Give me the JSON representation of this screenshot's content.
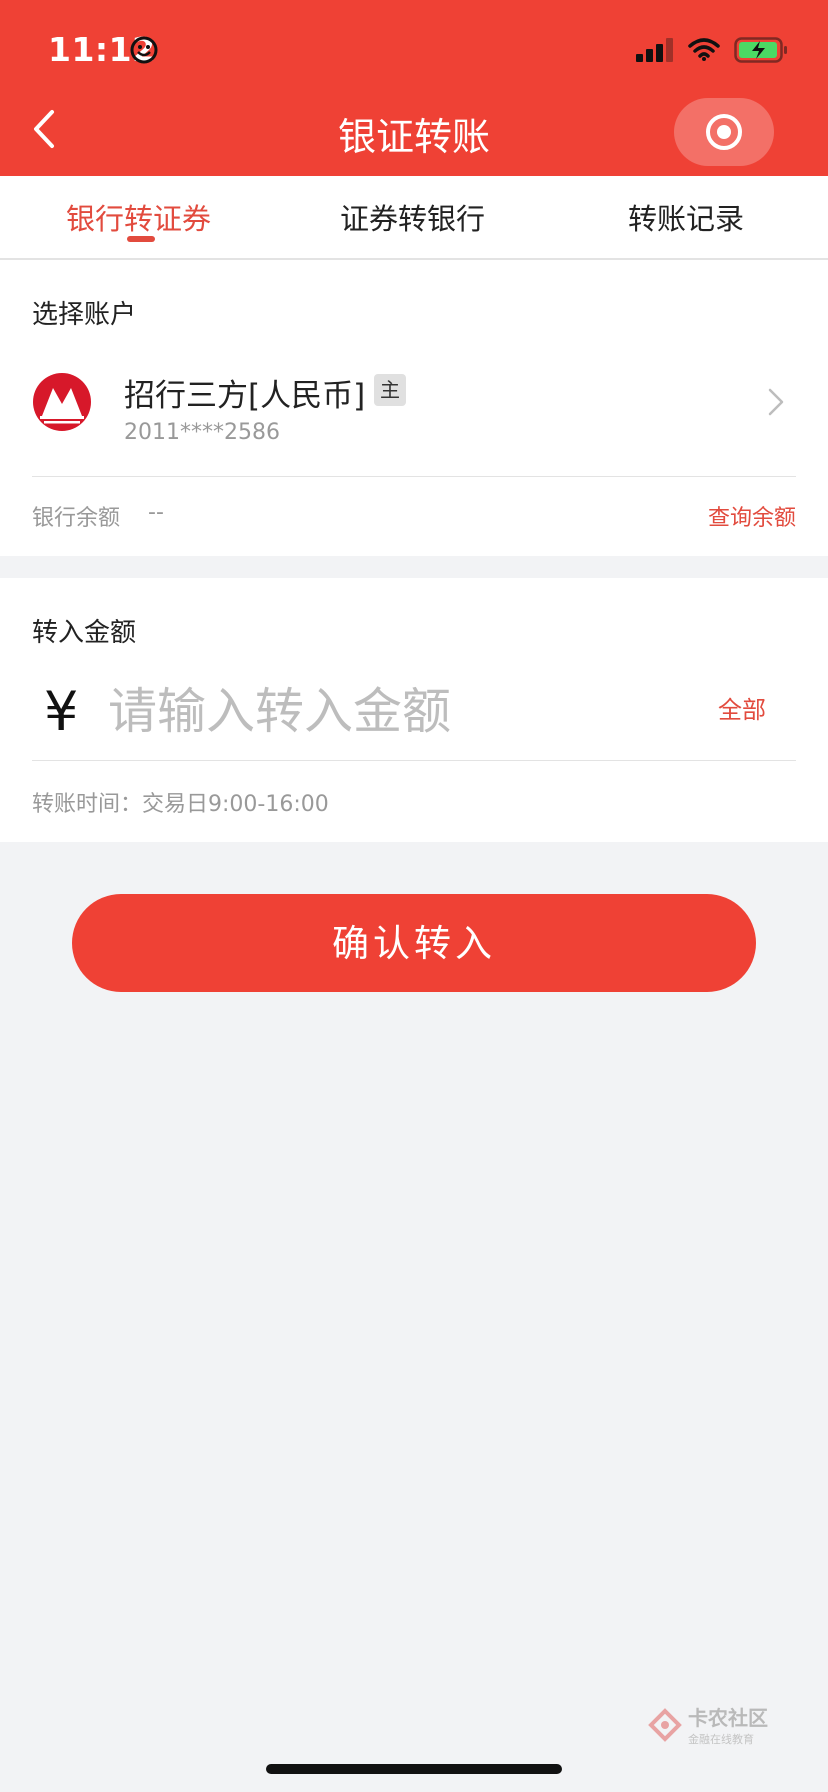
{
  "status_bar": {
    "time": "11:12"
  },
  "nav": {
    "title": "银证转账"
  },
  "tabs": [
    {
      "label": "银行转证券",
      "active": true
    },
    {
      "label": "证券转银行",
      "active": false
    },
    {
      "label": "转账记录",
      "active": false
    }
  ],
  "account": {
    "section_title": "选择账户",
    "bank_name": "招行三方[人民币]",
    "badge": "主",
    "account_number": "2011****2586",
    "balance_label": "银行余额",
    "balance_value": "--",
    "query_label": "查询余额"
  },
  "transfer": {
    "section_title": "转入金额",
    "currency_symbol": "¥",
    "placeholder": "请输入转入金额",
    "all_label": "全部",
    "time_label": "转账时间：交易日9:00-16:00"
  },
  "confirm_label": "确认转入",
  "watermark": {
    "main": "卡农社区",
    "sub": "金融在线教育"
  },
  "colors": {
    "accent": "#ef4135",
    "link": "#e24b3e",
    "background": "#f2f3f5"
  }
}
